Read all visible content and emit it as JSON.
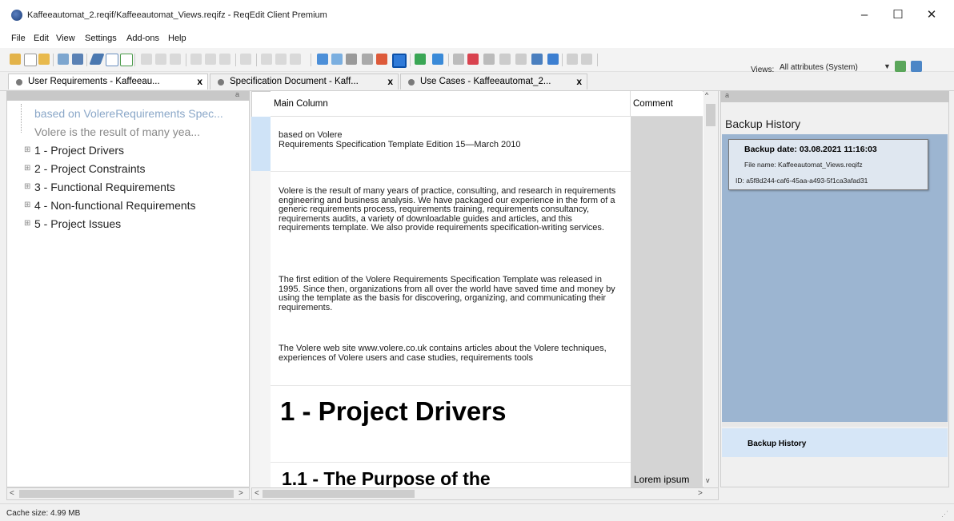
{
  "window": {
    "title": "Kaffeeautomat_2.reqif/Kaffeeautomat_Views.reqifz - ReqEdit Client Premium",
    "min": "–",
    "max": "☐",
    "close": "✕"
  },
  "menu": [
    "File",
    "Edit",
    "View",
    "Settings",
    "Add-ons",
    "Help"
  ],
  "toolbar": {
    "views_label": "Views:",
    "views_value": "All attributes (System)"
  },
  "tabs": [
    {
      "label": "User Requirements - Kaffeeau...",
      "active": true
    },
    {
      "label": "Specification Document - Kaff...",
      "active": false
    },
    {
      "label": "Use Cases - Kaffeeautomat_2...",
      "active": false
    }
  ],
  "tab_close": "x",
  "tree": {
    "header_num": "a",
    "items": [
      "based on VolereRequirements Spec...",
      "Volere is the result of many yea...",
      "1 - Project Drivers",
      "2 - Project Constraints",
      "3 - Functional Requirements",
      "4 - Non-functional Requirements",
      "5 - Project Issues"
    ]
  },
  "document": {
    "col_main": "Main Column",
    "col_comment": "Comment",
    "p1": "based on Volere\nRequirements Specification Template Edition 15—March 2010",
    "p2": "Volere is the result of many years of practice, consulting, and research in requirements engineering and business analysis. We have packaged our experience in the form of a generic requirements process, requirements training, requirements consultancy, requirements audits, a variety of downloadable guides and articles, and this requirements template. We also provide requirements specification-writing services.",
    "p3": "The first edition of the Volere Requirements Specification Template was released in 1995. Since then, organizations from all over the world have saved time and money by using the template as the basis for discovering, organizing, and communicating their requirements.",
    "p4": "The Volere web site www.volere.co.uk contains articles about the Volere techniques, experiences of Volere users and case studies, requirements tools",
    "h1": "1 - Project Drivers",
    "h2": "1.1 - The Purpose of the",
    "lorem": "Lorem ipsum"
  },
  "backup": {
    "header_num": "a",
    "title": "Backup History",
    "date": "Backup date: 03.08.2021 11:16:03",
    "file": "File name: Kaffeeautomat_Views.reqifz",
    "id": "ID: a5f8d244-caf6-45aa-a493-5f1ca3afad31",
    "tab_label": "Backup History"
  },
  "status": {
    "cache": "Cache size: 4.99 MB"
  },
  "colors": {
    "accent": "#9cb5d1",
    "selection": "#cfe3f7"
  }
}
